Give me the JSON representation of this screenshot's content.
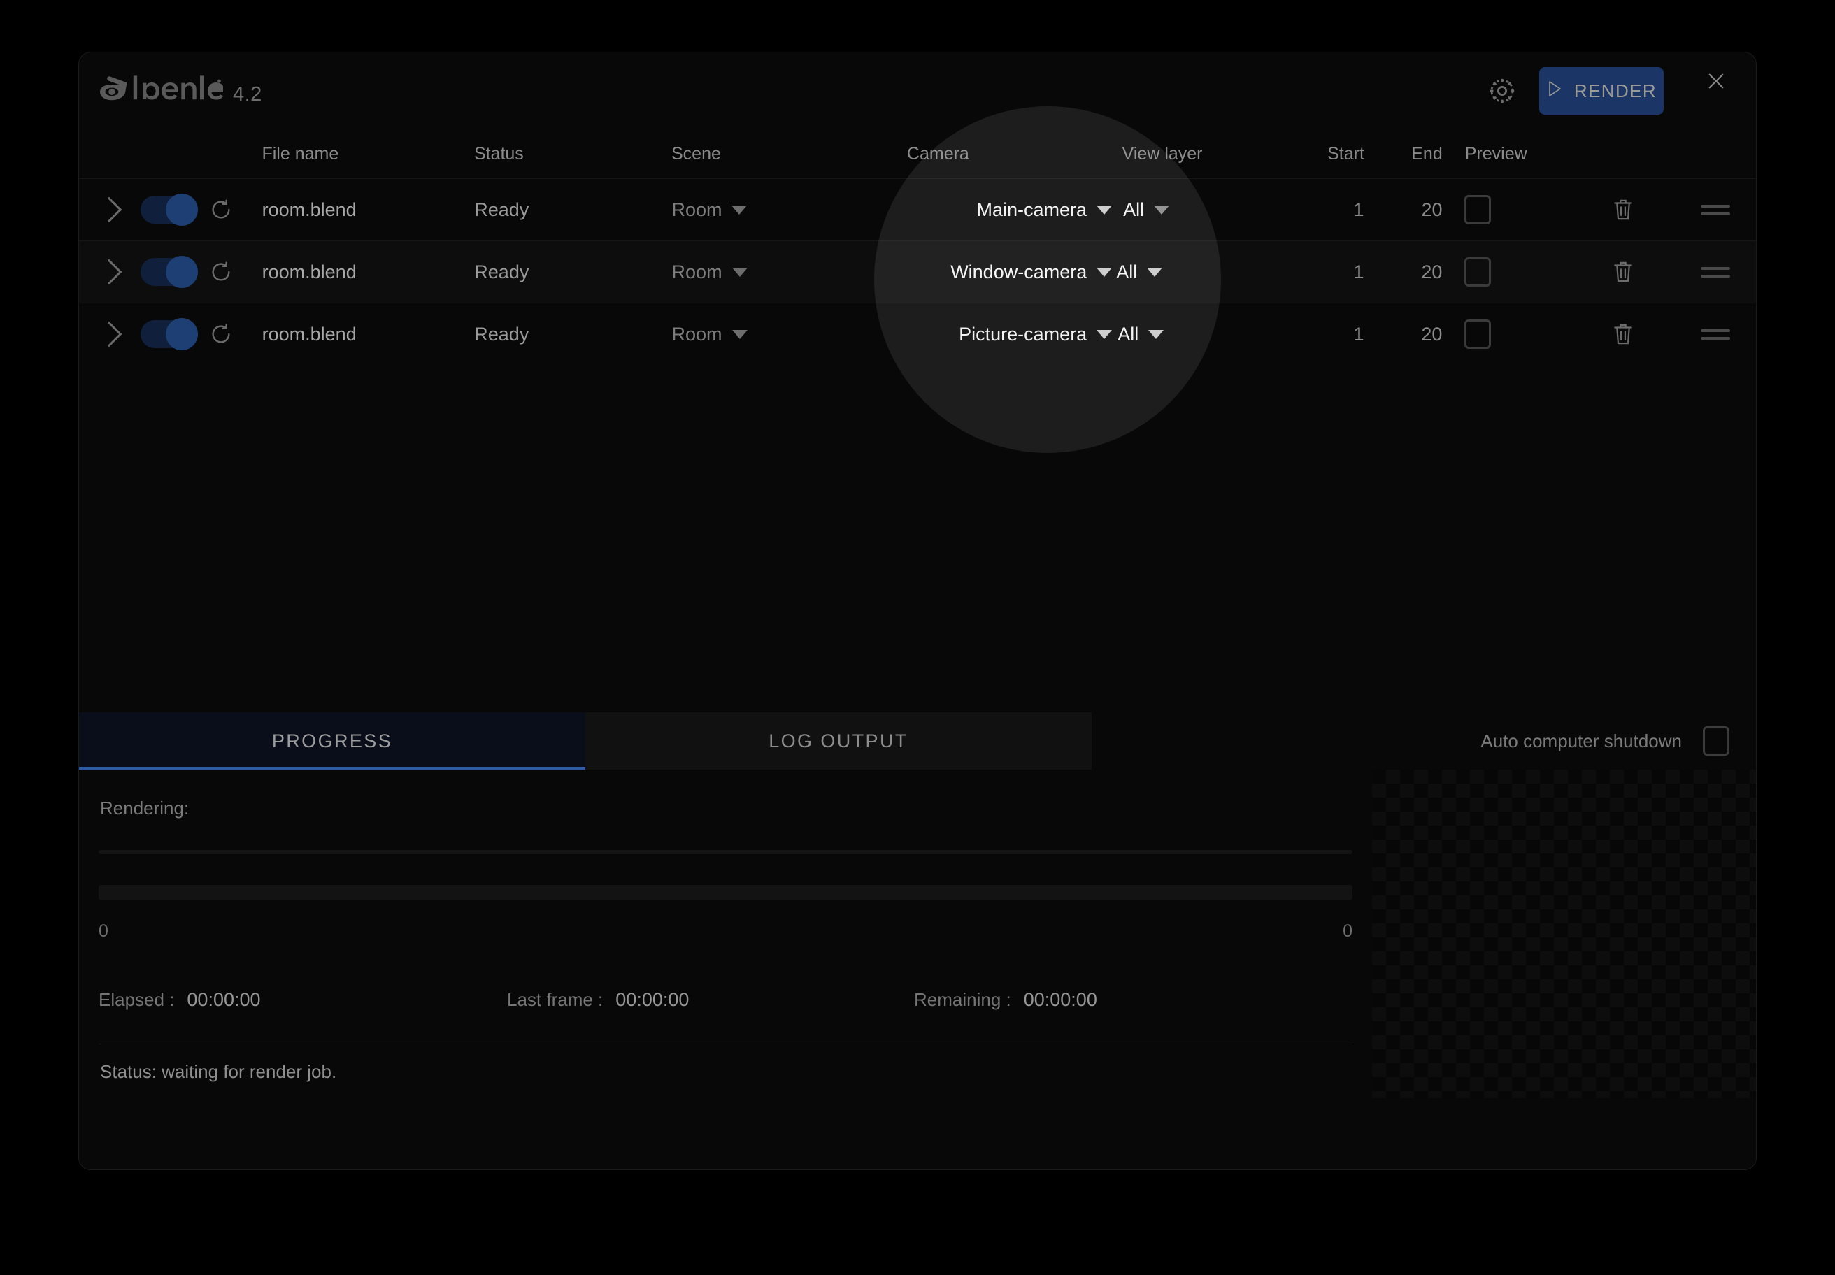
{
  "app": {
    "name": "blender",
    "version": "4.2",
    "logo_icon": "blender-logo-icon"
  },
  "titlebar": {
    "settings_icon": "gear-icon",
    "render_label": "RENDER",
    "render_play_icon": "play-triangle-icon",
    "close_icon": "close-icon"
  },
  "table": {
    "headers": {
      "file_name": "File name",
      "status": "Status",
      "scene": "Scene",
      "camera": "Camera",
      "view_layer": "View layer",
      "start": "Start",
      "end": "End",
      "preview": "Preview"
    },
    "rows": [
      {
        "expand_icon": "chevron-right-icon",
        "enabled": true,
        "refresh_icon": "refresh-icon",
        "file_name": "room.blend",
        "status": "Ready",
        "scene": "Room",
        "camera": "Main-camera",
        "view_layer": "All",
        "start": "1",
        "end": "20",
        "preview_checked": false,
        "delete_icon": "trash-icon",
        "drag_icon": "drag-handle-icon"
      },
      {
        "expand_icon": "chevron-right-icon",
        "enabled": true,
        "refresh_icon": "refresh-icon",
        "file_name": "room.blend",
        "status": "Ready",
        "scene": "Room",
        "camera": "Window-camera",
        "view_layer": "All",
        "start": "1",
        "end": "20",
        "preview_checked": false,
        "delete_icon": "trash-icon",
        "drag_icon": "drag-handle-icon"
      },
      {
        "expand_icon": "chevron-right-icon",
        "enabled": true,
        "refresh_icon": "refresh-icon",
        "file_name": "room.blend",
        "status": "Ready",
        "scene": "Room",
        "camera": "Picture-camera",
        "view_layer": "All",
        "start": "1",
        "end": "20",
        "preview_checked": false,
        "delete_icon": "trash-icon",
        "drag_icon": "drag-handle-icon"
      }
    ]
  },
  "tabs": {
    "progress": "PROGRESS",
    "log_output": "LOG OUTPUT",
    "active": "PROGRESS"
  },
  "options": {
    "auto_shutdown_label": "Auto computer shutdown",
    "auto_shutdown_checked": false
  },
  "progress": {
    "rendering_label": "Rendering:",
    "bar_left_value": "0",
    "bar_right_value": "0",
    "elapsed_label": "Elapsed :",
    "elapsed_value": "00:00:00",
    "last_frame_label": "Last frame :",
    "last_frame_value": "00:00:00",
    "remaining_label": "Remaining :",
    "remaining_value": "00:00:00",
    "status": "Status: waiting for render job."
  },
  "preview_panel": {
    "name": "render-preview-checkerboard"
  },
  "colors": {
    "accent_blue": "#2f5aa8",
    "render_button_bg": "#1b3666",
    "toggle_on": "#1d3f73",
    "window_bg": "#080808",
    "page_bg": "#000000"
  }
}
